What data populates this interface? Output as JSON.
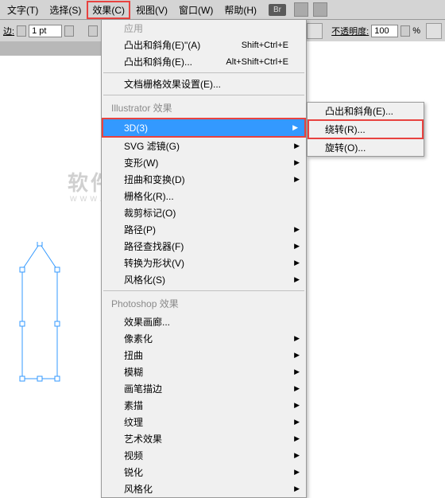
{
  "menubar": {
    "items": [
      "文字(T)",
      "选择(S)",
      "效果(C)",
      "视图(V)",
      "窗口(W)",
      "帮助(H)"
    ],
    "highlighted_index": 2,
    "br_label": "Br"
  },
  "optbar": {
    "left_label": "边:",
    "stroke_value": "1 pt",
    "opacity_label": "不透明度:",
    "opacity_value": "100",
    "percent": "%"
  },
  "watermark": {
    "main": "软件自学网",
    "sub": "www.rjzxw.com"
  },
  "menu": {
    "top": [
      {
        "label": "应用",
        "disabled": true,
        "shortcut": ""
      },
      {
        "label": "凸出和斜角(E)\"(A)",
        "shortcut": "Shift+Ctrl+E"
      },
      {
        "label": "凸出和斜角(E)...",
        "shortcut": "Alt+Shift+Ctrl+E"
      }
    ],
    "doc_raster": "文档栅格效果设置(E)...",
    "header_ai": "Illustrator 效果",
    "ai_items": [
      {
        "label": "3D(3)",
        "arrow": true,
        "hl": true
      },
      {
        "label": "SVG 滤镜(G)",
        "arrow": true
      },
      {
        "label": "变形(W)",
        "arrow": true
      },
      {
        "label": "扭曲和变换(D)",
        "arrow": true
      },
      {
        "label": "栅格化(R)..."
      },
      {
        "label": "裁剪标记(O)"
      },
      {
        "label": "路径(P)",
        "arrow": true
      },
      {
        "label": "路径查找器(F)",
        "arrow": true
      },
      {
        "label": "转换为形状(V)",
        "arrow": true
      },
      {
        "label": "风格化(S)",
        "arrow": true
      }
    ],
    "header_ps": "Photoshop 效果",
    "ps_items": [
      {
        "label": "效果画廊..."
      },
      {
        "label": "像素化",
        "arrow": true
      },
      {
        "label": "扭曲",
        "arrow": true
      },
      {
        "label": "模糊",
        "arrow": true
      },
      {
        "label": "画笔描边",
        "arrow": true
      },
      {
        "label": "素描",
        "arrow": true
      },
      {
        "label": "纹理",
        "arrow": true
      },
      {
        "label": "艺术效果",
        "arrow": true
      },
      {
        "label": "视频",
        "arrow": true
      },
      {
        "label": "锐化",
        "arrow": true
      },
      {
        "label": "风格化",
        "arrow": true
      }
    ]
  },
  "submenu": {
    "items": [
      {
        "label": "凸出和斜角(E)..."
      },
      {
        "label": "绕转(R)...",
        "boxed": true
      },
      {
        "label": "旋转(O)..."
      }
    ]
  }
}
